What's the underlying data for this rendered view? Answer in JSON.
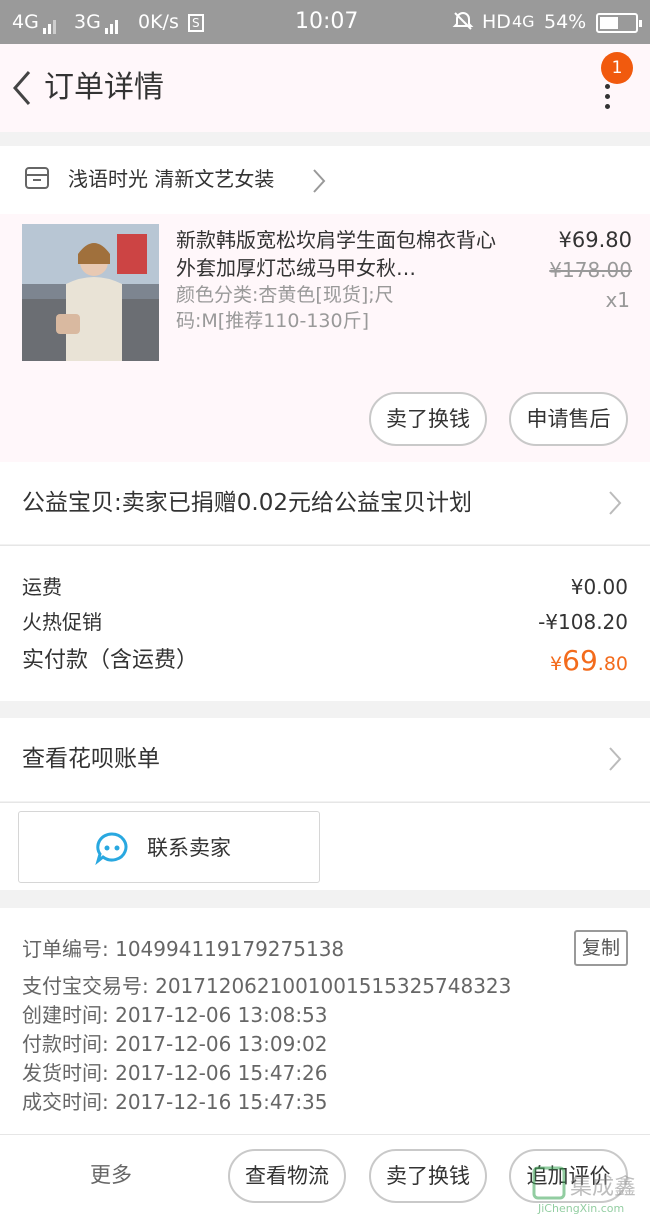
{
  "status_bar": {
    "net1": "4G",
    "net2": "3G",
    "speed": "0K/s",
    "s_box": "S",
    "time": "10:07",
    "hd": "HD",
    "net3": "4G",
    "battery": "54%",
    "battery_level": 0.54
  },
  "nav": {
    "title": "订单详情",
    "badge_count": "1"
  },
  "shop": {
    "name": "浅语时光 清新文艺女装"
  },
  "item": {
    "title": "新款韩版宽松坎肩学生面包棉衣背心外套加厚灯芯绒马甲女秋…",
    "sku": "颜色分类:杏黄色[现货];尺码:M[推荐110-130斤]",
    "price": "¥69.80",
    "original_price": "¥178.00",
    "quantity": "x1",
    "btn_resell": "卖了换钱",
    "btn_aftersale": "申请售后"
  },
  "charity": {
    "text": "公益宝贝:卖家已捐赠0.02元给公益宝贝计划"
  },
  "fees": {
    "shipping_label": "运费",
    "shipping_value": "¥0.00",
    "promo_label": "火热促销",
    "promo_value": "-¥108.20",
    "paid_label": "实付款（含运费）",
    "paid_currency": "¥",
    "paid_int": "69",
    "paid_dec": ".80"
  },
  "huabei": {
    "text": "查看花呗账单"
  },
  "contact": {
    "label": "联系卖家"
  },
  "order_info": {
    "order_no": "订单编号: 104994119179275138",
    "copy_label": "复制",
    "alipay_no": "支付宝交易号: 2017120621001001515325748323",
    "created": "创建时间: 2017-12-06 13:08:53",
    "paid": "付款时间: 2017-12-06 13:09:02",
    "shipped": "发货时间: 2017-12-06 15:47:26",
    "completed": "成交时间: 2017-12-16 15:47:35"
  },
  "bottom_bar": {
    "more": "更多",
    "logistics": "查看物流",
    "resell": "卖了换钱",
    "review": "追加评价"
  },
  "watermark": {
    "text": "JiChengXin.com",
    "mark": "集成鑫"
  },
  "colors": {
    "accent": "#f36b1c",
    "badge": "#f15a0e",
    "chat_icon": "#29a8e0"
  }
}
